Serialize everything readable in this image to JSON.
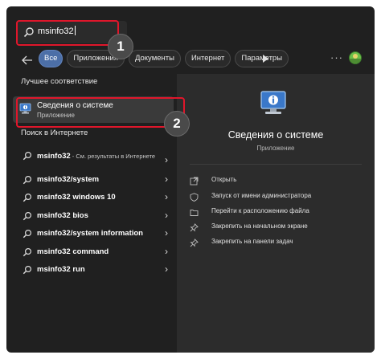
{
  "search": {
    "value": "msinfo32"
  },
  "badges": [
    "1",
    "2"
  ],
  "chips": [
    "Все",
    "Приложения",
    "Документы",
    "Интернет",
    "Параметры"
  ],
  "more_label": "···",
  "best_match": {
    "heading": "Лучшее соответствие",
    "title": "Сведения о системе",
    "subtitle": "Приложение"
  },
  "web": {
    "heading": "Поиск в Интернете",
    "first": {
      "label": "msinfo32",
      "sub": " - См. результаты в Интернете"
    },
    "items": [
      "msinfo32/system",
      "msinfo32 windows 10",
      "msinfo32 bios",
      "msinfo32/system information",
      "msinfo32 command",
      "msinfo32 run"
    ]
  },
  "detail": {
    "title": "Сведения о системе",
    "subtitle": "Приложение",
    "actions": [
      {
        "label": "Открыть",
        "icon": "open-icon"
      },
      {
        "label": "Запуск от имени администратора",
        "icon": "shield-icon"
      },
      {
        "label": "Перейти к расположению файла",
        "icon": "folder-icon"
      },
      {
        "label": "Закрепить на начальном экране",
        "icon": "pin-icon"
      },
      {
        "label": "Закрепить на панели задач",
        "icon": "pin-icon"
      }
    ]
  },
  "colors": {
    "accent": "#4c6fa7",
    "highlight": "#e0162b",
    "background": "#202020",
    "panel": "#2c2c2c"
  }
}
